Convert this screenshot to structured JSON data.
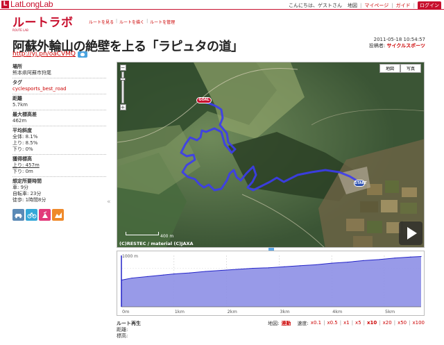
{
  "header": {
    "logo_text": "LatLongLab",
    "greeting": "こんにちは、ゲストさん",
    "nav": [
      "地図",
      "マイページ",
      "ガイド"
    ],
    "login": "ログイン"
  },
  "brand": {
    "title": "ルートラボ",
    "subtitle": "ROUTE LAB"
  },
  "sub_nav": [
    "ルートを見る",
    "ルートを描く",
    "ルートを管理"
  ],
  "route": {
    "title": "阿蘇外輪山の絶壁を上る「ラピュタの道」",
    "url": "http://yj.pn/oaCVMQ",
    "datetime": "2011-05-18 10:54:57",
    "poster_label": "投稿者:",
    "poster": "サイクルスポーツ"
  },
  "info": {
    "place_label": "場所",
    "place": "熊本県阿蘇市狩尾",
    "tag_label": "タグ",
    "tag": "cyclesports_best_road",
    "distance_label": "距離",
    "distance": "5.7km",
    "max_alt_label": "最大標高差",
    "max_alt": "462m",
    "slope_label": "平均斜度",
    "slope_all": "全体: 8.1%",
    "slope_up": "上り: 8.5%",
    "slope_down": "下り: 0%",
    "gain_label": "獲得標高",
    "gain_up": "上り: 457m",
    "gain_down": "下り: 0m",
    "time_label": "想定所要時間",
    "time_car": "車: 9分",
    "time_bike": "自転車: 23分",
    "time_walk": "徒歩: 1時間8分"
  },
  "modes": [
    {
      "name": "car-icon",
      "glyph": "車"
    },
    {
      "name": "bicycle-icon",
      "glyph": "自"
    },
    {
      "name": "walk-icon",
      "glyph": "歩"
    },
    {
      "name": "run-icon",
      "glyph": "走"
    }
  ],
  "map": {
    "type_buttons": [
      "地図",
      "写真"
    ],
    "scale_label": "400 m",
    "copyright": "(C)RESTEC / material (C)JAXA",
    "goal_label": "GOAL",
    "start_label": "START"
  },
  "chart_data": {
    "type": "area",
    "x": [
      0,
      0.2,
      0.5,
      0.8,
      1.0,
      1.3,
      1.6,
      1.9,
      2.2,
      2.5,
      2.8,
      3.1,
      3.4,
      3.7,
      4.0,
      4.3,
      4.6,
      4.9,
      5.2,
      5.5,
      5.7
    ],
    "y": [
      520,
      560,
      590,
      620,
      640,
      660,
      690,
      710,
      730,
      750,
      760,
      780,
      800,
      820,
      850,
      870,
      900,
      920,
      950,
      970,
      980
    ],
    "x_ticks": [
      "0m",
      "1km",
      "2km",
      "3km",
      "4km",
      "5km"
    ],
    "x_tick_values": [
      0,
      1,
      2,
      3,
      4,
      5
    ],
    "y_max_label": "1000 m",
    "xlim": [
      0,
      5.7
    ],
    "ylim": [
      0,
      1000
    ],
    "fill_color": "#8d8fe6",
    "line_color": "#2323c8"
  },
  "playback": {
    "title": "ルート再生",
    "map_label": "地図:",
    "map_mode": "連動",
    "speed_label": "速度:",
    "speeds": [
      "x0.1",
      "x0.5",
      "x1",
      "x5",
      "x10",
      "x20",
      "x50",
      "x100"
    ],
    "selected_speed": "x10",
    "distance_label": "距離:",
    "altitude_label": "標高:"
  }
}
